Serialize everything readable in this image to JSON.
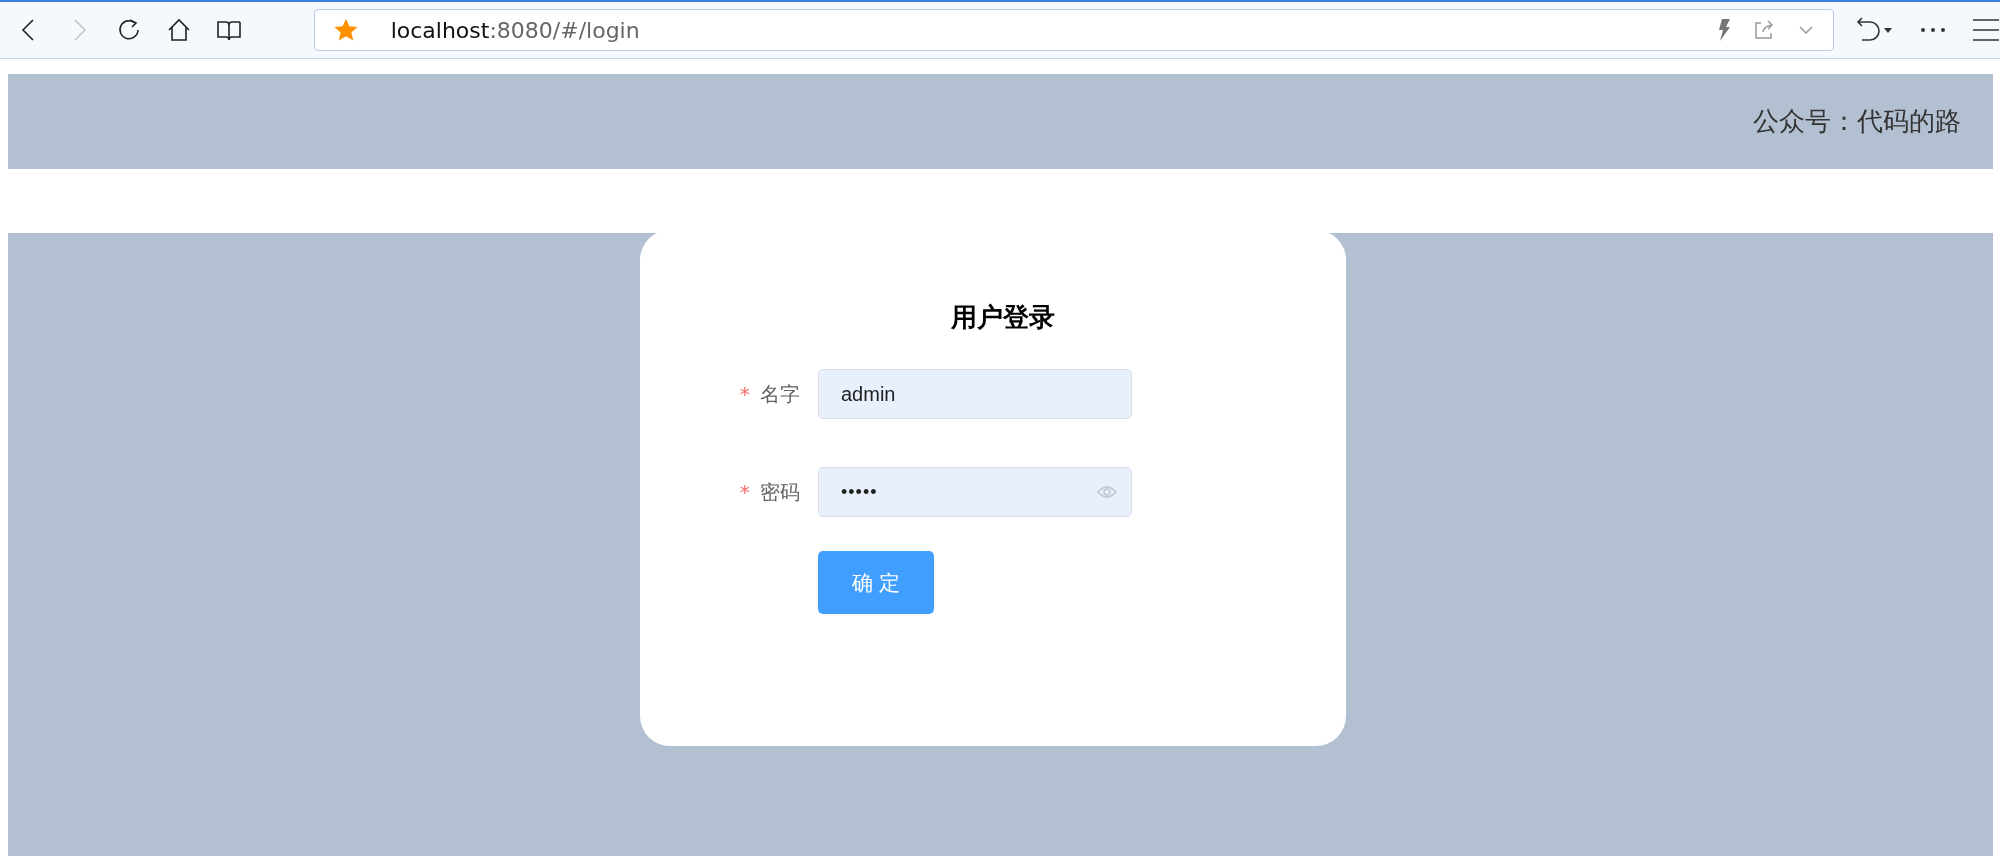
{
  "browser": {
    "nav_buttons": [
      {
        "kind": "back",
        "disabled": false
      },
      {
        "kind": "forward",
        "disabled": true
      },
      {
        "kind": "reload",
        "disabled": false
      },
      {
        "kind": "home",
        "disabled": false
      },
      {
        "kind": "reader",
        "disabled": false
      }
    ],
    "address": {
      "host": "localhost",
      "path": ":8080/#/login",
      "bookmarked": true
    }
  },
  "header": {
    "text": "公众号：代码的路"
  },
  "login": {
    "title": "用户登录",
    "fields": [
      {
        "kind": "text",
        "label": "名字",
        "required_mark": "*",
        "value": "admin"
      },
      {
        "kind": "password",
        "label": "密码",
        "required_mark": "*",
        "value": "•••••"
      }
    ],
    "submit": "确 定"
  }
}
